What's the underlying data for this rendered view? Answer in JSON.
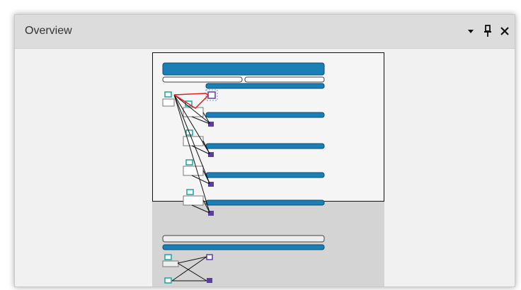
{
  "window": {
    "title": "Overview"
  },
  "titlebar_icons": [
    {
      "name": "dropdown-arrow-icon",
      "glyph": "▾"
    },
    {
      "name": "pin-icon",
      "glyph": "pin"
    },
    {
      "name": "close-icon",
      "glyph": "✕"
    }
  ],
  "colors": {
    "panel_bg": "#f1f1f1",
    "titlebar_bg": "#dcdcdc",
    "node_blue": "#1a7fb5",
    "node_dark_border": "#0d4e73",
    "connector_red": "#e0211f",
    "icon_teal": "#1aa59a",
    "icon_purple": "#5b3fa0",
    "viewport_border": "#111111",
    "doc_shade": "#d4d4d4"
  }
}
